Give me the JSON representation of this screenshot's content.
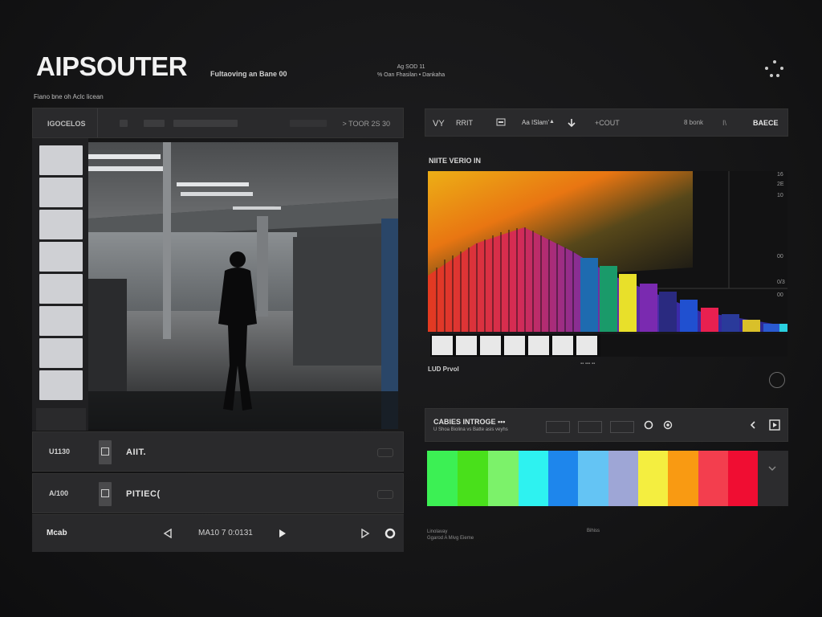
{
  "header": {
    "brand": "AIPSOUTER",
    "tagline": "Fultaoving an Bane 00",
    "note_line1": "Ag SOD 11",
    "note_line2": "% Oan Fhasilan • Dankaha",
    "sub_caption": "Fiano bne oh Aclc licean"
  },
  "left_panel": {
    "toolbar_label": "IGOCELOS",
    "toolbar_right": "> TOOR 2S 30",
    "rows": [
      {
        "code": "U1130",
        "label": "AIIT."
      },
      {
        "code": "A/100",
        "label": "PITIEC("
      }
    ],
    "transport": {
      "label": "Mcab",
      "time": "MA10 7 0:0131"
    }
  },
  "right_panel": {
    "toolbar": {
      "item1": "VY",
      "item2": "RRIT",
      "item3": "Aa ISlam'",
      "item4": "+COUT",
      "item5": "8 bonk",
      "item6": "I\\",
      "item7": "BAECE"
    },
    "chart_title": "NIITE VERIO IN",
    "axis_right": [
      "16",
      "2E",
      "10",
      "00",
      "0/3",
      "00"
    ],
    "chart_footer": "LUD Prvol",
    "mini_indicator": "▪▪ ▪▪▪ ▪▪",
    "panel": {
      "title": "CABIES INTROGE •••",
      "subtitle": "U Shoa Biolina vs Batte asis veyhs"
    },
    "palette_colors": [
      "#3cf054",
      "#49e01b",
      "#7cf26a",
      "#2ef2f0",
      "#1e86ec",
      "#64c4f4",
      "#9ea6d6",
      "#f4ee40",
      "#f99a12",
      "#f33e4e",
      "#f00d32"
    ],
    "footer_left_line1": "Linolavay",
    "footer_left_line2": "Ggarod A Mivg Eieme",
    "footer_right": "Bihiss"
  },
  "colors": {
    "background": "#161617",
    "panel": "#2a2a2c",
    "accent_orange": "#f9861a"
  },
  "icons": [
    "menu-dots-icon",
    "play-icon",
    "rewind-icon",
    "record-icon",
    "download-icon",
    "chevron-left-icon",
    "chevron-down-icon"
  ]
}
